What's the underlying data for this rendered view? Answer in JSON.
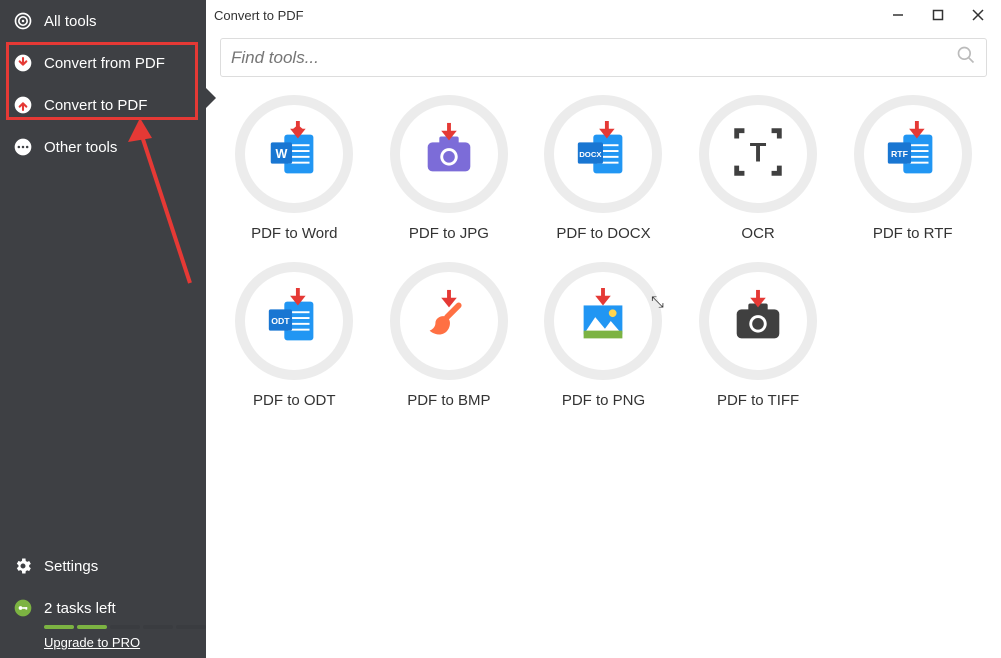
{
  "sidebar": {
    "items": [
      {
        "id": "all-tools",
        "label": "All tools"
      },
      {
        "id": "convert-from-pdf",
        "label": "Convert from PDF"
      },
      {
        "id": "convert-to-pdf",
        "label": "Convert to PDF"
      },
      {
        "id": "other-tools",
        "label": "Other tools"
      }
    ],
    "settings_label": "Settings",
    "tasks_label": "2 tasks left",
    "upgrade_label": "Upgrade to PRO",
    "tasks_filled": 2,
    "tasks_total": 5
  },
  "titlebar": {
    "title": "Convert to PDF"
  },
  "search": {
    "placeholder": "Find tools..."
  },
  "tools": [
    {
      "id": "pdf-to-word",
      "label": "PDF to Word"
    },
    {
      "id": "pdf-to-jpg",
      "label": "PDF to JPG"
    },
    {
      "id": "pdf-to-docx",
      "label": "PDF to DOCX"
    },
    {
      "id": "ocr",
      "label": "OCR"
    },
    {
      "id": "pdf-to-rtf",
      "label": "PDF to RTF"
    },
    {
      "id": "pdf-to-odt",
      "label": "PDF to ODT"
    },
    {
      "id": "pdf-to-bmp",
      "label": "PDF to BMP"
    },
    {
      "id": "pdf-to-png",
      "label": "PDF to PNG"
    },
    {
      "id": "pdf-to-tiff",
      "label": "PDF to TIFF"
    }
  ],
  "colors": {
    "sidebar_bg": "#3e4044",
    "accent_red": "#e53935",
    "accent_green": "#7cb342",
    "icon_blue": "#2196f3",
    "icon_purple": "#7c6cd8",
    "icon_dark": "#404040",
    "highlight_red": "#e53935"
  },
  "annotation": {
    "highlight_items": [
      "convert-from-pdf",
      "convert-to-pdf"
    ],
    "arrow": true
  }
}
